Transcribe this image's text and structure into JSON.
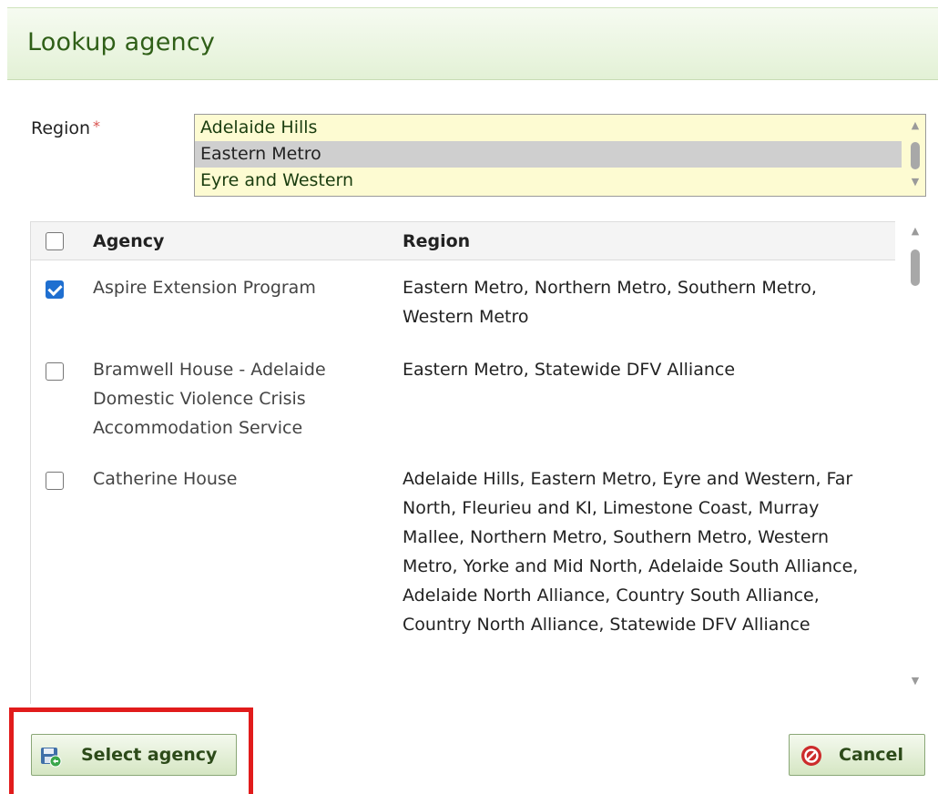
{
  "dialog": {
    "title": "Lookup agency"
  },
  "region_field": {
    "label": "Region",
    "required_mark": "*",
    "options": [
      {
        "label": "Adelaide Hills",
        "selected": false
      },
      {
        "label": "Eastern Metro",
        "selected": true
      },
      {
        "label": "Eyre and Western",
        "selected": false
      }
    ]
  },
  "table": {
    "headers": {
      "agency": "Agency",
      "region": "Region"
    },
    "rows": [
      {
        "agency": "Aspire Extension Program",
        "region": "Eastern Metro, Northern Metro, Southern Metro, Western Metro",
        "checked": true
      },
      {
        "agency": "Bramwell House - Adelaide Domestic Violence Crisis Accommodation Service",
        "region": "Eastern Metro, Statewide DFV Alliance",
        "checked": false
      },
      {
        "agency": "Catherine House",
        "region": "Adelaide Hills, Eastern Metro, Eyre and Western, Far North, Fleurieu and KI, Limestone Coast, Murray Mallee, Northern Metro, Southern Metro, Western Metro, Yorke and Mid North, Adelaide South Alliance, Adelaide North Alliance, Country South Alliance, Country North Alliance, Statewide DFV Alliance",
        "checked": false
      }
    ]
  },
  "footer": {
    "select_label": "Select agency",
    "cancel_label": "Cancel"
  },
  "colors": {
    "header_title": "#2f5f17",
    "list_bg": "#fdfbd2",
    "highlight": "#e11b1b",
    "checkbox_checked": "#1f6fd0"
  },
  "icons": {
    "select": "save-disk-icon",
    "cancel": "cancel-circle-icon"
  }
}
